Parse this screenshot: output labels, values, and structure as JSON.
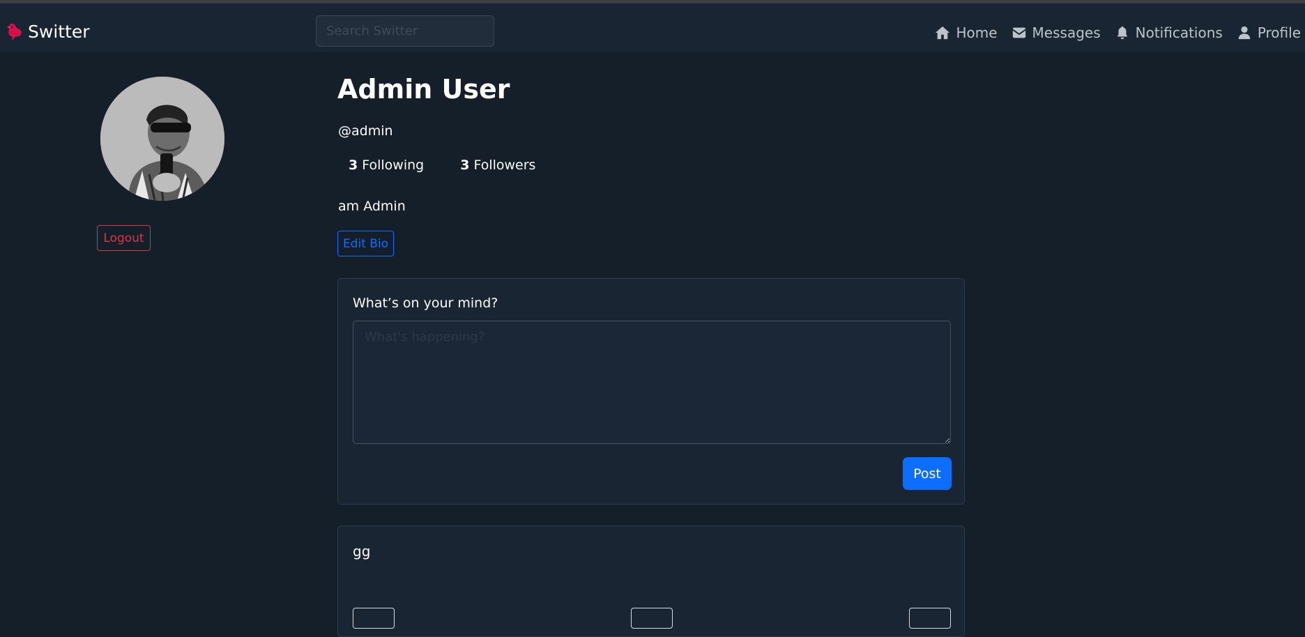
{
  "navbar": {
    "brand": "Switter",
    "search_placeholder": "Search Switter",
    "links": [
      {
        "label": "Home",
        "icon": "home-icon"
      },
      {
        "label": "Messages",
        "icon": "envelope-icon"
      },
      {
        "label": "Notifications",
        "icon": "bell-icon"
      },
      {
        "label": "Profile",
        "icon": "user-icon"
      }
    ]
  },
  "sidebar": {
    "logout_label": "Logout"
  },
  "profile": {
    "name": "Admin User",
    "handle": "@admin",
    "following_count": "3",
    "following_label": "Following",
    "followers_count": "3",
    "followers_label": "Followers",
    "bio": "am Admin",
    "edit_bio_label": "Edit Bio"
  },
  "compose": {
    "label": "What’s on your mind?",
    "placeholder": "What's happening?",
    "post_label": "Post"
  },
  "posts": [
    {
      "text": "gg"
    }
  ],
  "colors": {
    "background": "#151f2a",
    "navbar": "#1a2533",
    "primary": "#0d6efd",
    "danger": "#dc3545",
    "brand_icon": "#d6114a"
  }
}
